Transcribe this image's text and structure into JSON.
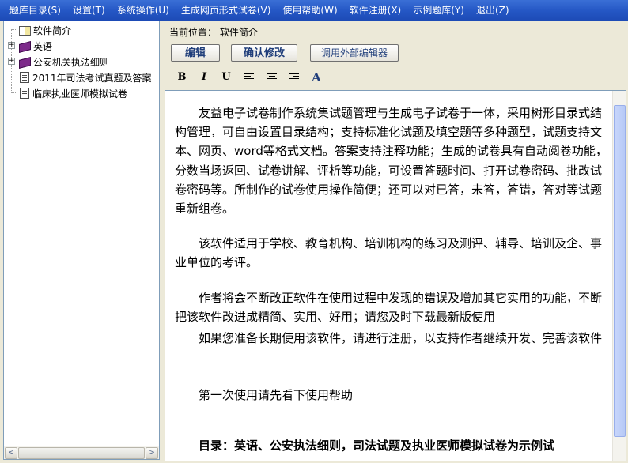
{
  "menu": [
    "题库目录(S)",
    "设置(T)",
    "系统操作(U)",
    "生成网页形式试卷(V)",
    "使用帮助(W)",
    "软件注册(X)",
    "示例题库(Y)",
    "退出(Z)"
  ],
  "tree": {
    "items": [
      {
        "label": "软件简介",
        "icon": "open-book-icon",
        "selected": true,
        "expandable": false
      },
      {
        "label": "英语",
        "icon": "book-icon",
        "expandable": true
      },
      {
        "label": "公安机关执法细则",
        "icon": "book-icon",
        "expandable": true
      },
      {
        "label": "2011年司法考试真题及答案",
        "icon": "document-icon",
        "expandable": false
      },
      {
        "label": "临床执业医师模拟试卷",
        "icon": "document-icon",
        "expandable": false
      }
    ],
    "expand_symbol": "+"
  },
  "location": {
    "text": "当前位置：  软件简介"
  },
  "toolbar": {
    "edit_label": "编辑",
    "confirm_label": "确认修改",
    "external_label": "调用外部编辑器"
  },
  "format": {
    "bold": "B",
    "italic": "I",
    "underline": "U",
    "font_color": "A"
  },
  "editor": {
    "paragraphs": [
      "友益电子试卷制作系统集试题管理与生成电子试卷于一体，采用树形目录式结构管理，可自由设置目录结构；支持标准化试题及填空题等多种题型，试题支持文本、网页、word等格式文档。答案支持注释功能；生成的试卷具有自动阅卷功能，分数当场返回、试卷讲解、评析等功能，可设置答题时间、打开试卷密码、批改试卷密码等。所制作的试卷使用操作简便；还可以对已答，未答，答错，答对等试题重新组卷。",
      "该软件适用于学校、教育机构、培训机构的练习及测评、辅导、培训及企、事业单位的考评。",
      "作者将会不断改正软件在使用过程中发现的错误及增加其它实用的功能，不断把该软件改进成精简、实用、好用；请您及时下载最新版使用",
      "如果您准备长期使用该软件，请进行注册，以支持作者继续开发、完善该软件",
      "第一次使用请先看下使用帮助",
      "目录：英语、公安执法细则，司法试题及执业医师模拟试卷为示例试"
    ]
  },
  "scroll": {
    "left_arrow": "<",
    "right_arrow": ">"
  }
}
